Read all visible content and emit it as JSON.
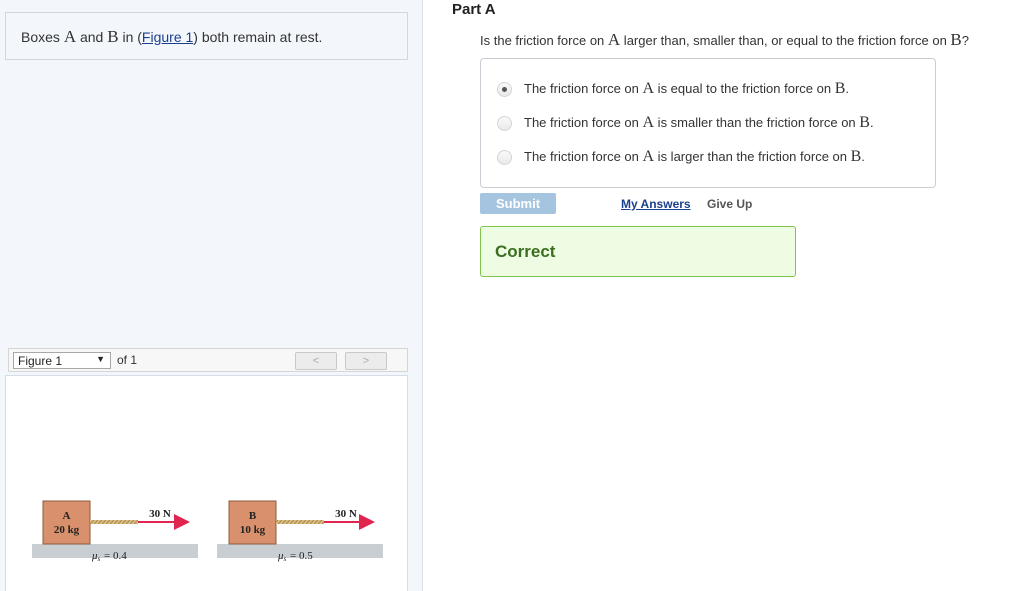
{
  "intro": {
    "before": "Boxes ",
    "var_a": "A",
    "and": " and ",
    "var_b": "B",
    "in": " in (",
    "figure_link": "Figure 1",
    "after": ") both remain at rest."
  },
  "figure_nav": {
    "select_value": "Figure 1",
    "of_label": "of 1",
    "prev_label": "<",
    "next_label": ">"
  },
  "figure": {
    "box_a": {
      "label": "A",
      "mass": "20 kg",
      "force": "30 N",
      "mu": "= 0.4"
    },
    "box_b": {
      "label": "B",
      "mass": "10 kg",
      "force": "30 N",
      "mu": "= 0.5"
    },
    "mu_symbol": "μ",
    "mu_sub": "s",
    "colors": {
      "box": "#d9906c",
      "arrow": "#e0254f",
      "rope": "#c8a96a",
      "ground": "#c8ced2"
    }
  },
  "part": {
    "title": "Part A",
    "question_before": "Is the friction force on ",
    "question_var_a": "A",
    "question_middle": " larger than, smaller than, or equal to the friction force on ",
    "question_var_b": "B",
    "question_end": "?"
  },
  "choices": [
    {
      "before": "The friction force on ",
      "var1": "A",
      "middle": " is equal to the friction force on ",
      "var2": "B",
      "end": ".",
      "selected": true
    },
    {
      "before": "The friction force on ",
      "var1": "A",
      "middle": " is smaller than the friction force on ",
      "var2": "B",
      "end": ".",
      "selected": false
    },
    {
      "before": "The friction force on ",
      "var1": "A",
      "middle": " is larger than the friction force on ",
      "var2": "B",
      "end": ".",
      "selected": false
    }
  ],
  "actions": {
    "submit_label": "Submit",
    "my_answers_label": "My Answers",
    "give_up_label": "Give Up"
  },
  "result": {
    "label": "Correct"
  }
}
